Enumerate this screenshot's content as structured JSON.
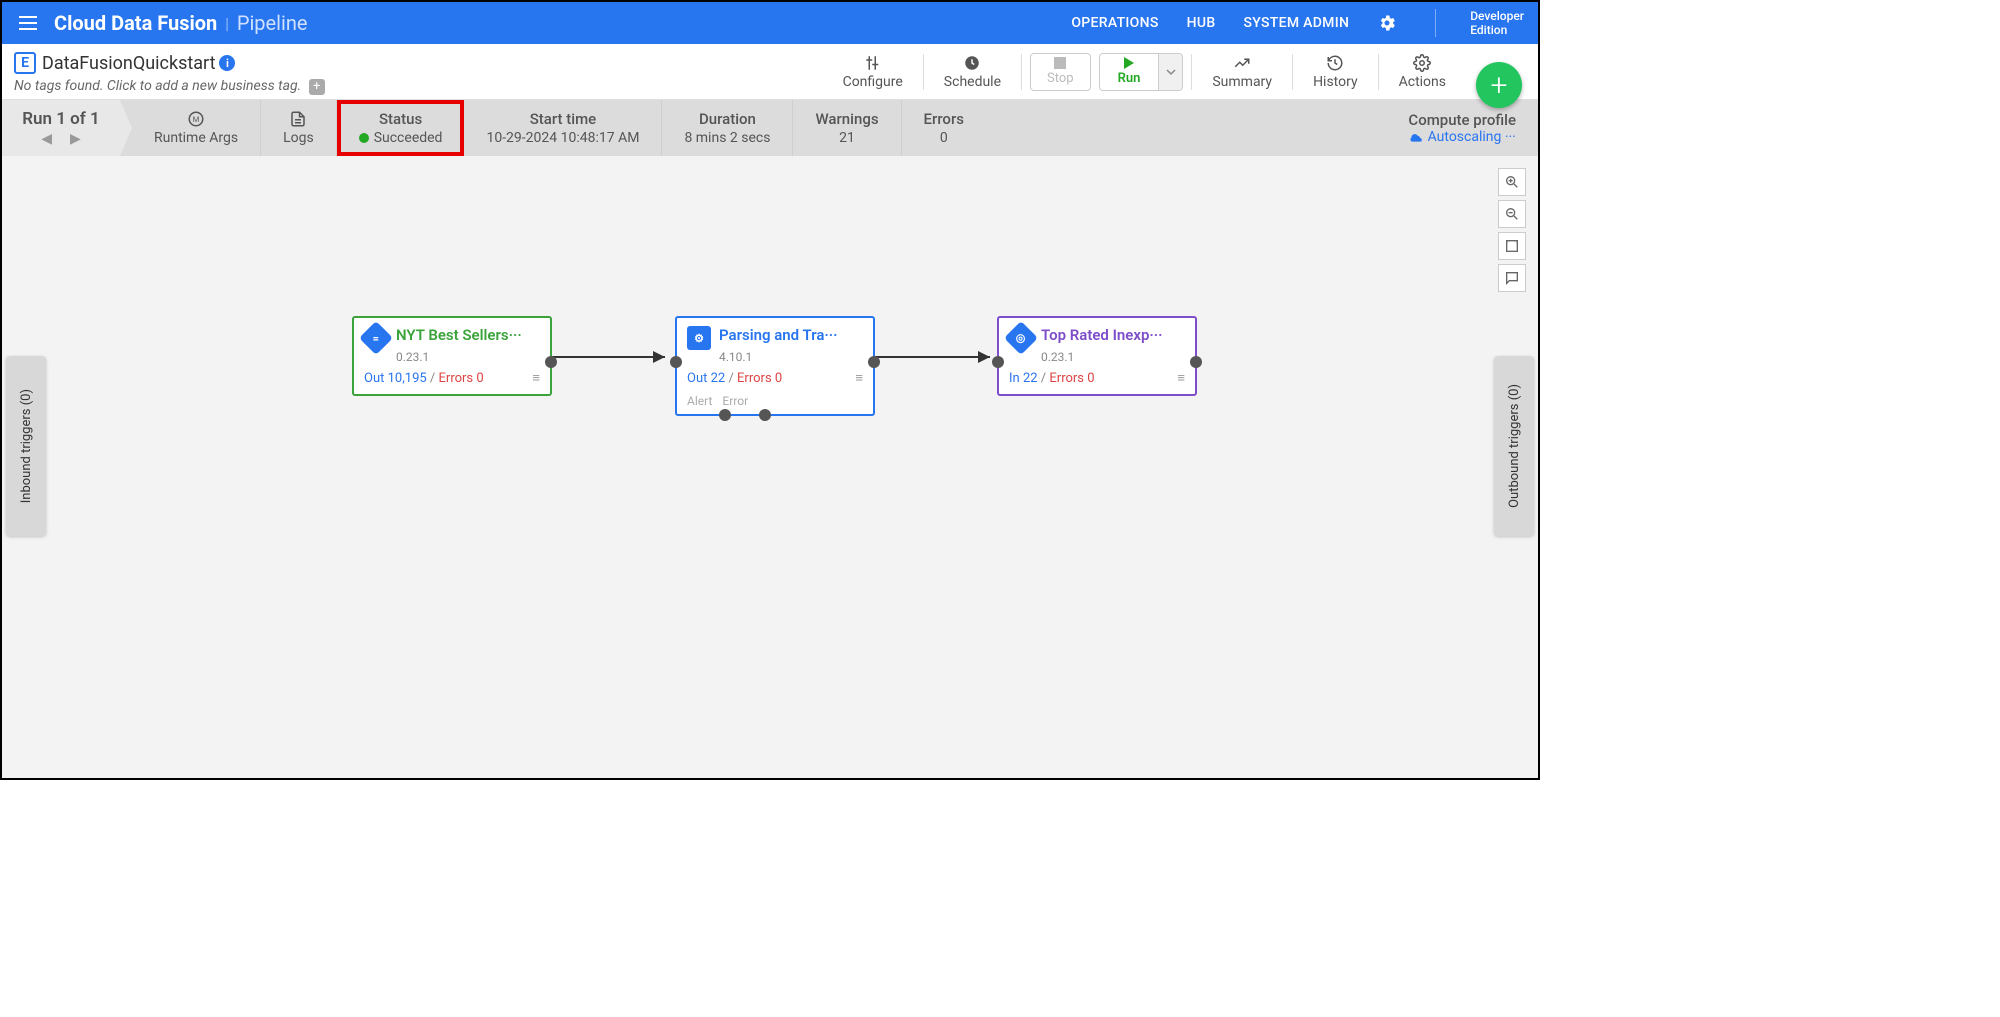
{
  "nav": {
    "brand": "Cloud Data Fusion",
    "page": "Pipeline",
    "links": {
      "operations": "OPERATIONS",
      "hub": "HUB",
      "sysadmin": "SYSTEM ADMIN"
    },
    "edition_l1": "Developer",
    "edition_l2": "Edition"
  },
  "header": {
    "pipeline_name": "DataFusionQuickstart",
    "tags_text": "No tags found. Click to add a new business tag.",
    "configure": "Configure",
    "schedule": "Schedule",
    "stop": "Stop",
    "run": "Run",
    "summary": "Summary",
    "history": "History",
    "actions": "Actions"
  },
  "runbar": {
    "run_label": "Run 1 of 1",
    "runtime_args": "Runtime Args",
    "logs": "Logs",
    "status_lbl": "Status",
    "status_val": "Succeeded",
    "start_lbl": "Start time",
    "start_val": "10-29-2024 10:48:17 AM",
    "duration_lbl": "Duration",
    "duration_val": "8 mins 2 secs",
    "warnings_lbl": "Warnings",
    "warnings_val": "21",
    "errors_lbl": "Errors",
    "errors_val": "0",
    "compute_lbl": "Compute profile",
    "compute_val": "Autoscaling ···"
  },
  "triggers": {
    "inbound": "Inbound triggers (0)",
    "outbound": "Outbound triggers (0)"
  },
  "nodes": {
    "n1": {
      "title": "NYT Best Sellers···",
      "version": "0.23.1",
      "out_lbl": "Out 10,195",
      "err_lbl": "Errors 0"
    },
    "n2": {
      "title": "Parsing and Tra···",
      "version": "4.10.1",
      "out_lbl": "Out 22",
      "err_lbl": "Errors 0",
      "alert": "Alert",
      "error": "Error"
    },
    "n3": {
      "title": "Top Rated Inexp···",
      "version": "0.23.1",
      "in_lbl": "In 22",
      "err_lbl": "Errors 0"
    }
  }
}
